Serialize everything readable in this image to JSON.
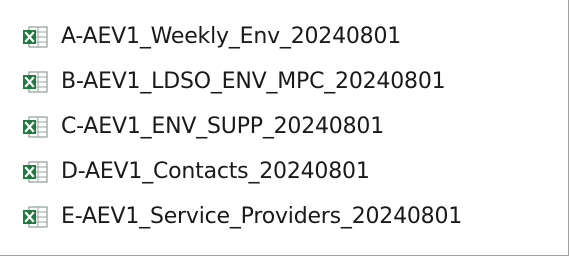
{
  "files": [
    {
      "name": "A-AEV1_Weekly_Env_20240801",
      "icon": "excel-csv-file-icon"
    },
    {
      "name": "B-AEV1_LDSO_ENV_MPC_20240801",
      "icon": "excel-csv-file-icon"
    },
    {
      "name": "C-AEV1_ENV_SUPP_20240801",
      "icon": "excel-csv-file-icon"
    },
    {
      "name": "D-AEV1_Contacts_20240801",
      "icon": "excel-csv-file-icon"
    },
    {
      "name": "E-AEV1_Service_Providers_20240801",
      "icon": "excel-csv-file-icon"
    }
  ],
  "colors": {
    "excel_green": "#1f7a3f",
    "sheet_border": "#7a8c7e",
    "grid_line": "#9aa8a0"
  }
}
